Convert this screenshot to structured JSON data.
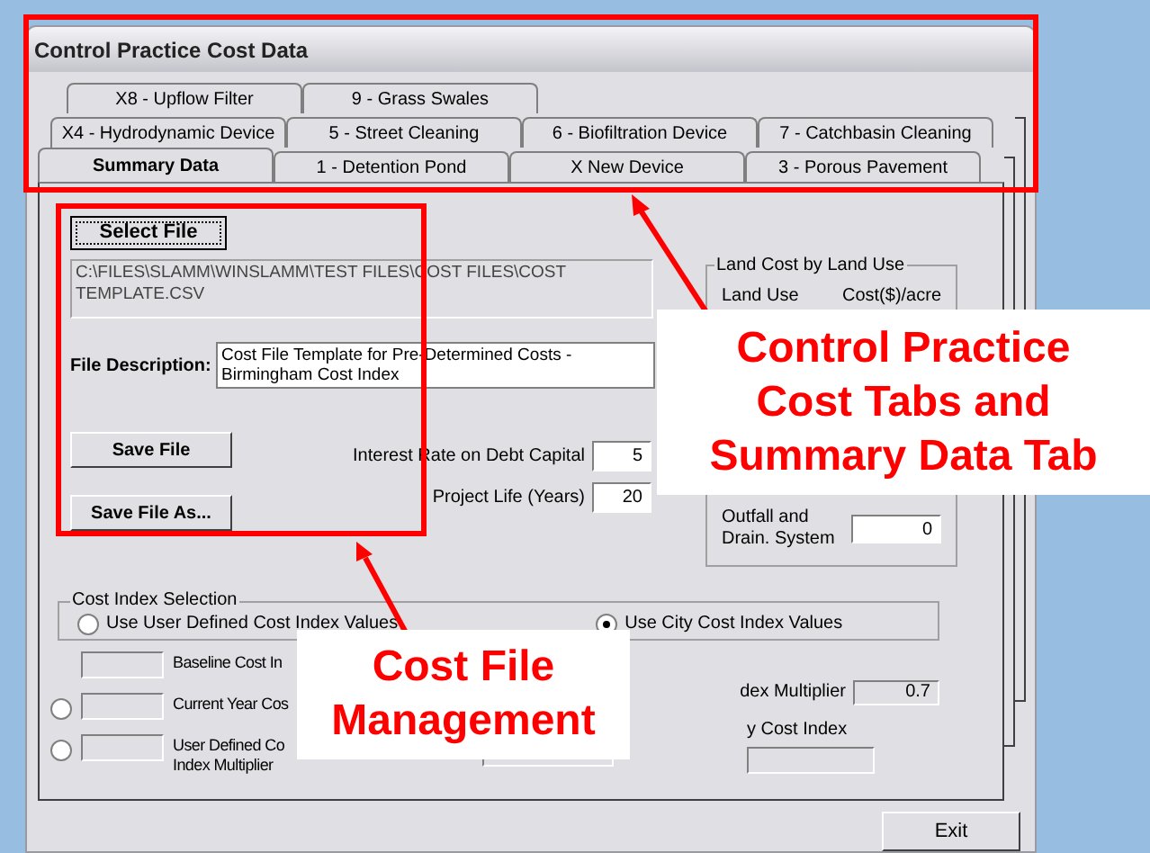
{
  "window": {
    "title": "Control Practice Cost Data"
  },
  "tab_rows": [
    {
      "tabs": [
        {
          "label": "X8 - Upflow Filter",
          "selected": false
        },
        {
          "label": "9 - Grass Swales",
          "selected": false
        }
      ]
    },
    {
      "tabs": [
        {
          "label": "X4 - Hydrodynamic Device",
          "selected": false
        },
        {
          "label": "5 - Street Cleaning",
          "selected": false
        },
        {
          "label": "6 - Biofiltration Device",
          "selected": false
        },
        {
          "label": "7 - Catchbasin Cleaning",
          "selected": false
        }
      ]
    },
    {
      "tabs": [
        {
          "label": "Summary Data",
          "selected": true
        },
        {
          "label": "1 - Detention Pond",
          "selected": false
        },
        {
          "label": "X New Device",
          "selected": false
        },
        {
          "label": "3 - Porous Pavement",
          "selected": false
        }
      ]
    }
  ],
  "summary": {
    "select_button": "Select File",
    "file_path": "C:\\FILES\\SLAMM\\WINSLAMM\\TEST FILES\\COST FILES\\COST TEMPLATE.CSV",
    "description_label": "File Description:",
    "description": "Cost File Template for Pre-Determined Costs - Birmingham Cost Index",
    "save_button": "Save File",
    "save_as_button": "Save File As...",
    "interest_label": "Interest Rate on Debt Capital",
    "interest_value": "5",
    "life_label": "Project Life (Years)",
    "life_value": "20"
  },
  "land_cost": {
    "title": "Land Cost by Land Use",
    "column_1": "Land Use",
    "column_2": "Cost($)/acre",
    "rows": [
      {
        "label": "Outfall and Drain. System",
        "value": "0"
      }
    ]
  },
  "cost_index": {
    "title": "Cost Index Selection",
    "options": [
      {
        "label": "Use User Defined Cost Index Values",
        "selected": false
      },
      {
        "label": "Use City Cost Index Values",
        "selected": true
      }
    ]
  },
  "index_fields": [
    {
      "kind": "plain",
      "lines": [
        "Baseline Cost In"
      ]
    },
    {
      "kind": "radio",
      "selected": false,
      "lines": [
        "Current Year Cos"
      ]
    },
    {
      "kind": "radio",
      "selected": false,
      "lines": [
        "User Defined Co",
        "Index Multiplier"
      ]
    }
  ],
  "city_multiplier": {
    "label": "dex Multiplier",
    "value": "0.7"
  },
  "city_index": {
    "label": "y Cost Index"
  },
  "exit_button": "Exit",
  "callouts": [
    {
      "lines": [
        "Control Practice",
        "Cost Tabs and",
        "Summary Data Tab"
      ]
    },
    {
      "lines": [
        "Cost File",
        "Management"
      ]
    }
  ]
}
